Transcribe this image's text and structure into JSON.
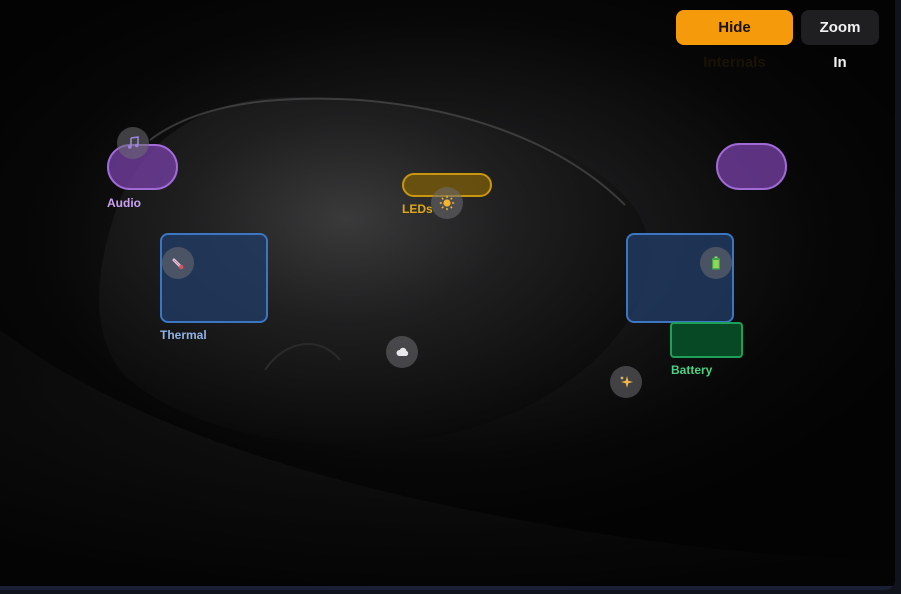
{
  "toolbar": {
    "hide_label": "Hide Internals",
    "zoom_label": "Zoom In"
  },
  "components": {
    "audio": {
      "label": "Audio",
      "color": "#c9a2f0"
    },
    "leds": {
      "label": "LEDs",
      "color": "#e0a819"
    },
    "thermal": {
      "label": "Thermal",
      "color": "#8fb3e6"
    },
    "battery": {
      "label": "Battery",
      "color": "#4fcf84"
    }
  },
  "hotspots": [
    {
      "name": "music-icon"
    },
    {
      "name": "sun-icon"
    },
    {
      "name": "thermometer-icon"
    },
    {
      "name": "battery-icon"
    },
    {
      "name": "cloud-icon"
    },
    {
      "name": "sparkles-icon"
    }
  ],
  "colors": {
    "accent": "#f59a0b",
    "audio": "#a06bd6",
    "thermal": "#3b76c2",
    "leds": "#c8960f",
    "battery": "#1fa05a"
  }
}
